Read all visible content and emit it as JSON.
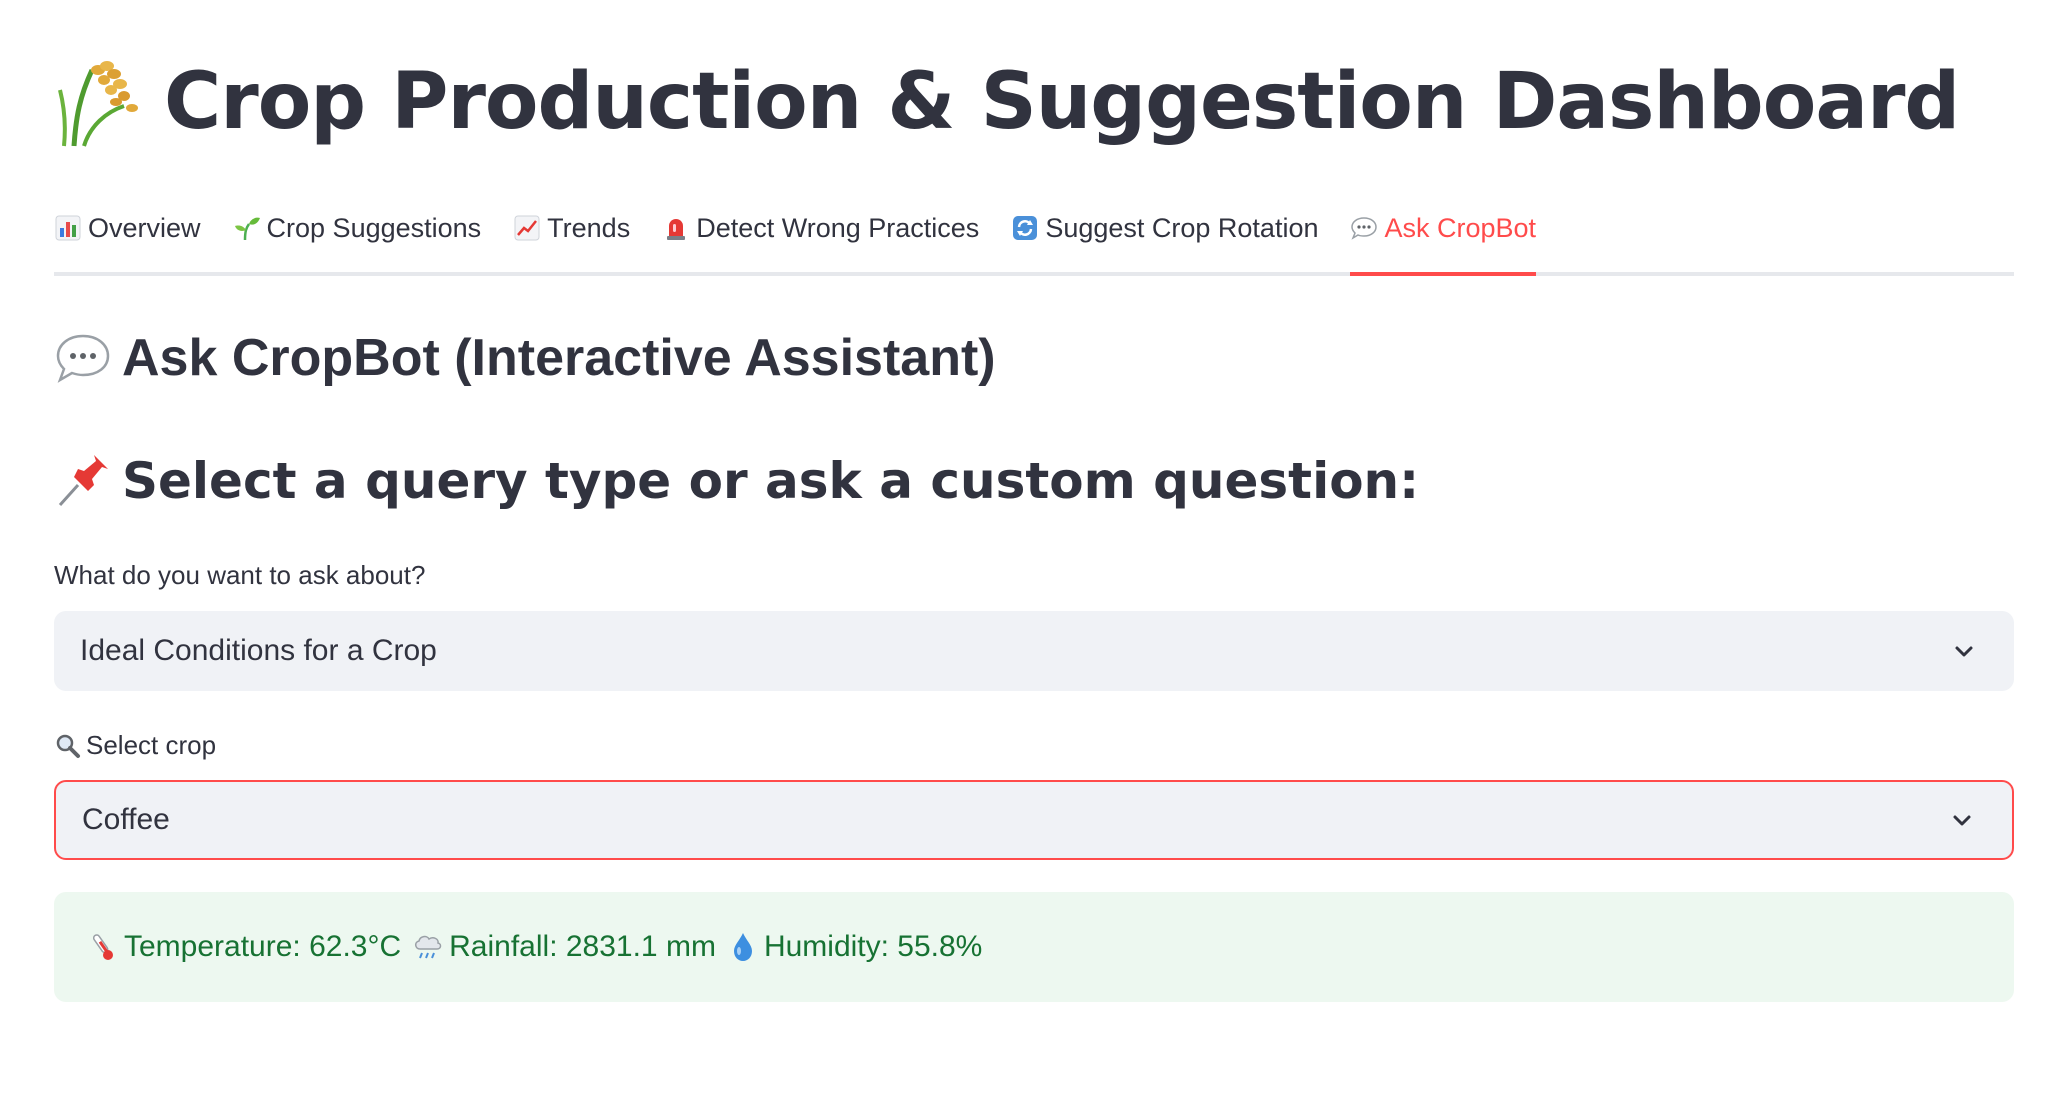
{
  "header": {
    "title": "Crop Production & Suggestion Dashboard",
    "icon": "rice-plant-icon"
  },
  "tabs": [
    {
      "label": "Overview",
      "icon": "bar-chart-icon",
      "active": false
    },
    {
      "label": "Crop Suggestions",
      "icon": "seedling-icon",
      "active": false
    },
    {
      "label": "Trends",
      "icon": "trend-up-icon",
      "active": false
    },
    {
      "label": "Detect Wrong Practices",
      "icon": "siren-icon",
      "active": false
    },
    {
      "label": "Suggest Crop Rotation",
      "icon": "rotation-icon",
      "active": false
    },
    {
      "label": "Ask CropBot",
      "icon": "speech-bubble-icon",
      "active": true
    }
  ],
  "section": {
    "heading": "Ask CropBot (Interactive Assistant)",
    "subheading": "Select a query type or ask a custom question:"
  },
  "query_select": {
    "label": "What do you want to ask about?",
    "value": "Ideal Conditions for a Crop"
  },
  "crop_select": {
    "label": "Select crop",
    "value": "Coffee"
  },
  "result": {
    "temperature": "Temperature: 62.3°C",
    "rainfall": "Rainfall: 2831.1 mm",
    "humidity": "Humidity: 55.8%"
  },
  "colors": {
    "accent": "#ff4b4b",
    "text": "#31333f",
    "input_bg": "#f0f2f6",
    "success_bg": "#edf8f0",
    "success_text": "#177233"
  }
}
